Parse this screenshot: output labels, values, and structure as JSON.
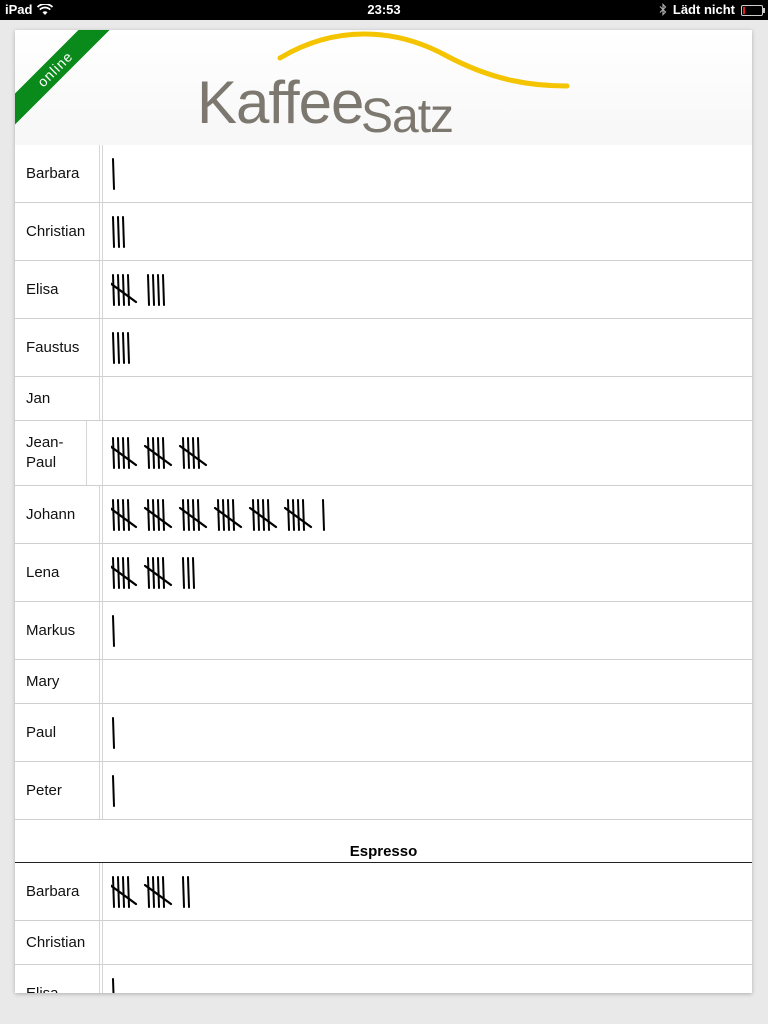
{
  "status_bar": {
    "device": "iPad",
    "time": "23:53",
    "charging": "Lädt nicht"
  },
  "header": {
    "ribbon": "online",
    "logo_part1": "Kaffee",
    "logo_part2": "Satz",
    "logo_swoosh_color": "#f5c400",
    "logo_text_color": "#7d786f",
    "ribbon_color": "#0a8a1a"
  },
  "coffee_rows": [
    {
      "name": "Barbara",
      "count": 1
    },
    {
      "name": "Christian",
      "count": 3
    },
    {
      "name": "Elisa",
      "count": 9
    },
    {
      "name": "Faustus",
      "count": 4
    },
    {
      "name": "Jan",
      "count": 0
    },
    {
      "name": "Jean-Paul",
      "count": 15
    },
    {
      "name": "Johann",
      "count": 31
    },
    {
      "name": "Lena",
      "count": 13
    },
    {
      "name": "Markus",
      "count": 1
    },
    {
      "name": "Mary",
      "count": 0
    },
    {
      "name": "Paul",
      "count": 1
    },
    {
      "name": "Peter",
      "count": 1
    }
  ],
  "espresso": {
    "title": "Espresso",
    "rows": [
      {
        "name": "Barbara",
        "count": 12
      },
      {
        "name": "Christian",
        "count": 0
      },
      {
        "name": "Elisa",
        "count": 1
      }
    ]
  }
}
